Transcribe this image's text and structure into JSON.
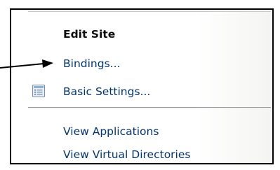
{
  "actions_pane": {
    "section_title": "Edit Site",
    "items": [
      {
        "label": "Bindings..."
      },
      {
        "label": "Basic Settings..."
      }
    ],
    "secondary_items": [
      {
        "label": "View Applications"
      },
      {
        "label": "View Virtual Directories"
      }
    ]
  },
  "colors": {
    "link_text": "#04346e",
    "divider": "#9a9a9a",
    "frame_border": "#000000"
  },
  "icons": {
    "basic_settings": "settings-list-icon",
    "annotation": "callout-arrow-icon"
  }
}
